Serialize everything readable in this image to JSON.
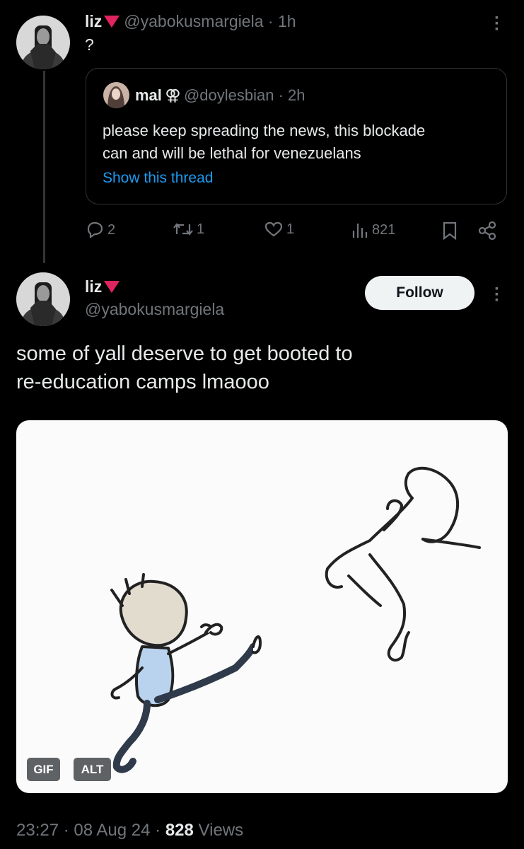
{
  "tweet1": {
    "name": "liz",
    "name_flag": "🔻",
    "handle": "@yabokusmargiela",
    "time": "1h",
    "text": "?"
  },
  "quote": {
    "name": "mal",
    "name_symbol": "⚢",
    "handle": "@doylesbian",
    "time": "2h",
    "text_line1": "please keep spreading the news, this blockade",
    "text_line2": "can and will be lethal for venezuelans",
    "show_thread": "Show this thread"
  },
  "actions": {
    "replies": "2",
    "retweets": "1",
    "likes": "1",
    "views": "821"
  },
  "tweet2": {
    "name": "liz",
    "handle": "@yabokusmargiela",
    "follow_label": "Follow",
    "text_line1": "some of yall deserve to get booted to",
    "text_line2": "re-education camps lmaooo",
    "gif_badge": "GIF",
    "alt_badge": "ALT",
    "timestamp": "23:27 · 08 Aug 24 ·",
    "views_count": "828",
    "views_label": "Views"
  },
  "colors": {
    "background": "#000000",
    "text": "#e7e9ea",
    "muted": "#71767b",
    "link": "#1d9bf0",
    "red_flag": "#e0245e"
  }
}
